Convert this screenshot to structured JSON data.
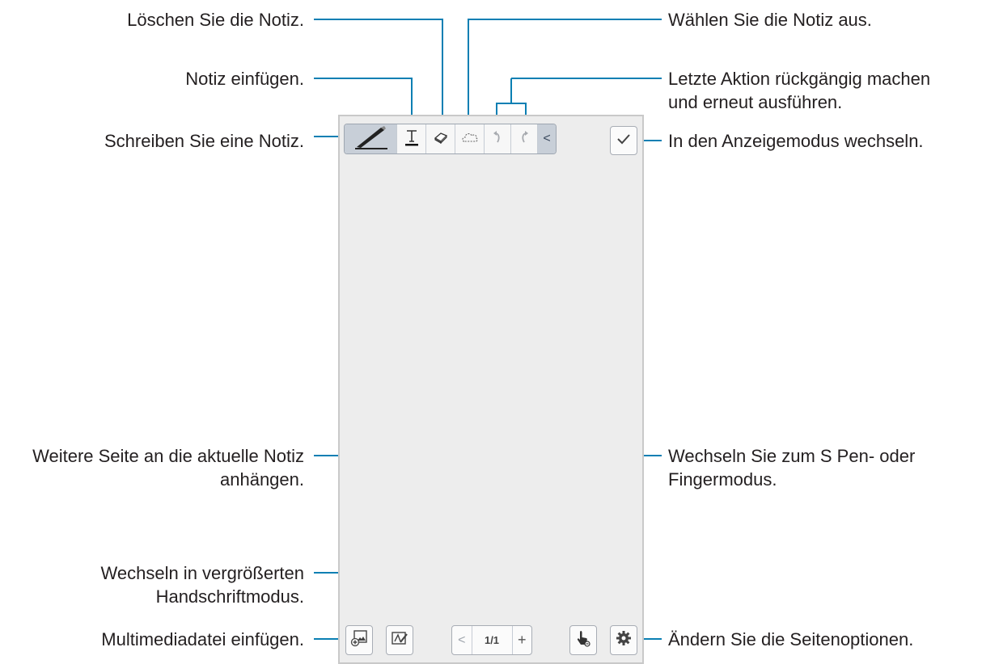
{
  "callouts": {
    "delete_note": "Löschen Sie die Notiz.",
    "insert_note": "Notiz einfügen.",
    "write_note": "Schreiben Sie eine Notiz.",
    "select_note": "Wählen Sie die Notiz aus.",
    "undo_redo_line1": "Letzte Aktion rückgängig machen",
    "undo_redo_line2": "und erneut ausführen.",
    "view_mode": "In den Anzeigemodus wechseln.",
    "add_page_line1": "Weitere Seite an die aktuelle Notiz",
    "add_page_line2": "anhängen.",
    "zoom_handwriting_line1": "Wechseln in vergrößerten",
    "zoom_handwriting_line2": "Handschriftmodus.",
    "insert_media": "Multimediadatei einfügen.",
    "pen_finger_line1": "Wechseln Sie zum S Pen- oder",
    "pen_finger_line2": "Fingermodus.",
    "page_options": "Ändern Sie die Seitenoptionen."
  },
  "pager": {
    "page_indicator": "1/1",
    "prev": "<",
    "next": "+"
  },
  "toolbar": {
    "collapse": "<"
  },
  "icons": {
    "pen": "pen-icon",
    "text": "text-icon",
    "eraser": "eraser-icon",
    "selection": "lasso-selection-icon",
    "undo": "undo-icon",
    "redo": "redo-icon",
    "collapse": "chevron-left-icon",
    "done": "checkmark-icon",
    "insert_media": "insert-image-icon",
    "zoom_pad": "zoom-pad-icon",
    "pen_mode": "finger-touch-icon",
    "settings": "gear-icon"
  },
  "colors": {
    "leader_line": "#0a7fb3",
    "screen_bg": "#ededed",
    "pen_active_bg": "#c8cfd8"
  }
}
